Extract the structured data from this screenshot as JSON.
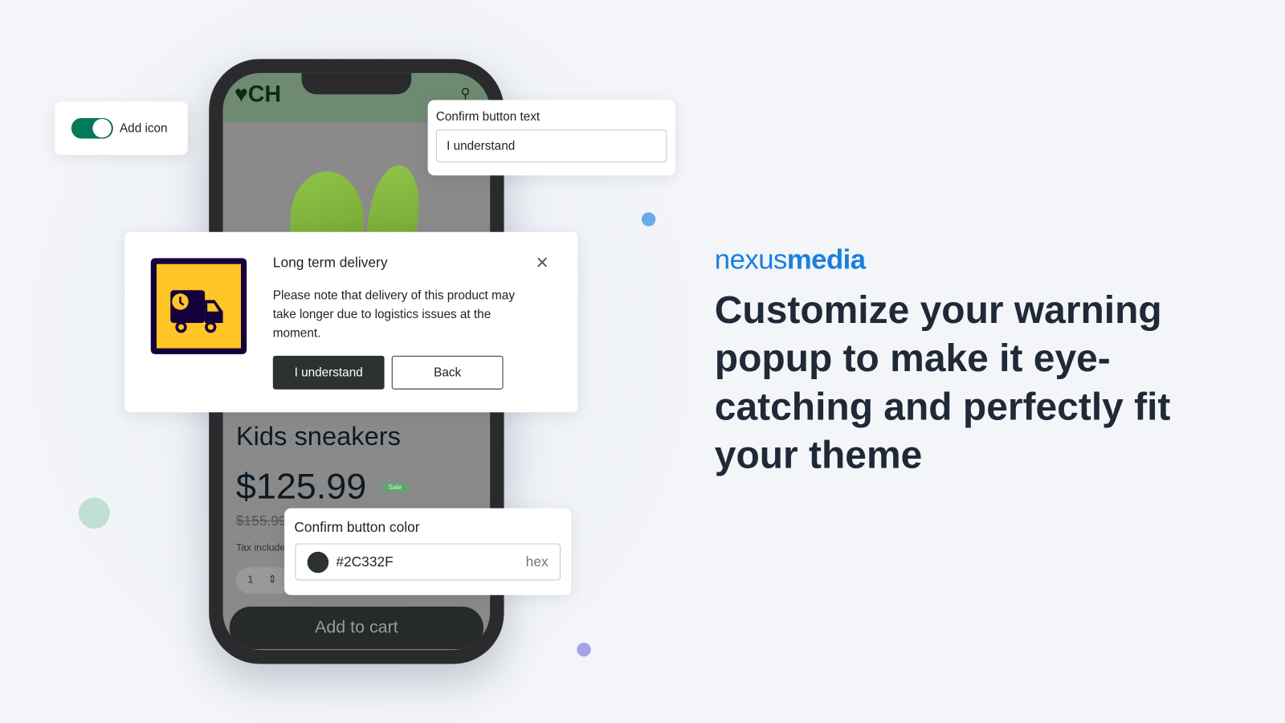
{
  "phone": {
    "logo_text": "CH",
    "product_title": "Kids sneakers",
    "price": "$125.99",
    "sale_badge": "Sale",
    "old_price": "$155.99",
    "tax_note": "Tax included.",
    "quantity": "1",
    "add_to_cart": "Add to cart"
  },
  "toggle_card": {
    "label": "Add icon",
    "checked": true,
    "color": "#007a5a"
  },
  "text_card": {
    "label": "Confirm button text",
    "value": "I understand"
  },
  "color_card": {
    "label": "Confirm button color",
    "value": "#2C332F",
    "suffix": "hex"
  },
  "popup": {
    "title": "Long term delivery",
    "body": "Please note that delivery of this product may take longer due to logistics issues at the moment.",
    "confirm_label": "I understand",
    "back_label": "Back",
    "icon": "truck-clock-icon",
    "icon_bg": "#ffc526",
    "icon_fg": "#14003a"
  },
  "brand": {
    "part1": "nexus",
    "part2": "media",
    "color": "#1a7fe0"
  },
  "headline": "Customize your warning popup to make it eye-catching and perfectly fit your theme"
}
